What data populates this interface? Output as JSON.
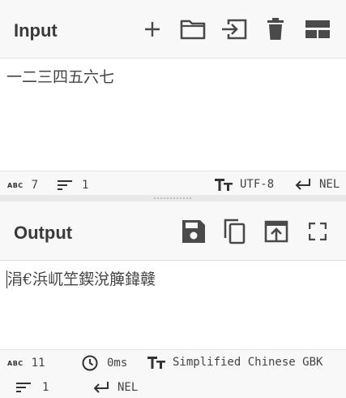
{
  "input": {
    "title": "Input",
    "text": "一二三四五六七",
    "stats": {
      "length": "7",
      "lines": "1",
      "encoding": "UTF-8",
      "eol": "NEL"
    },
    "icons": [
      "add-icon",
      "folder-open-icon",
      "import-icon",
      "trash-icon",
      "layout-icon"
    ]
  },
  "output": {
    "title": "Output",
    "text": "涓€浜屼笁鍥涗簲鍏竷",
    "stats": {
      "length": "11",
      "time": "0ms",
      "encoding": "Simplified Chinese GBK",
      "lines": "1",
      "eol": "NEL"
    },
    "icons": [
      "save-icon",
      "copy-icon",
      "replace-input-icon",
      "fullscreen-icon"
    ]
  },
  "colors": {
    "icon": "#4a4a4a",
    "header_bg": "#f8f8f8",
    "divider": "#e9e9e9"
  }
}
